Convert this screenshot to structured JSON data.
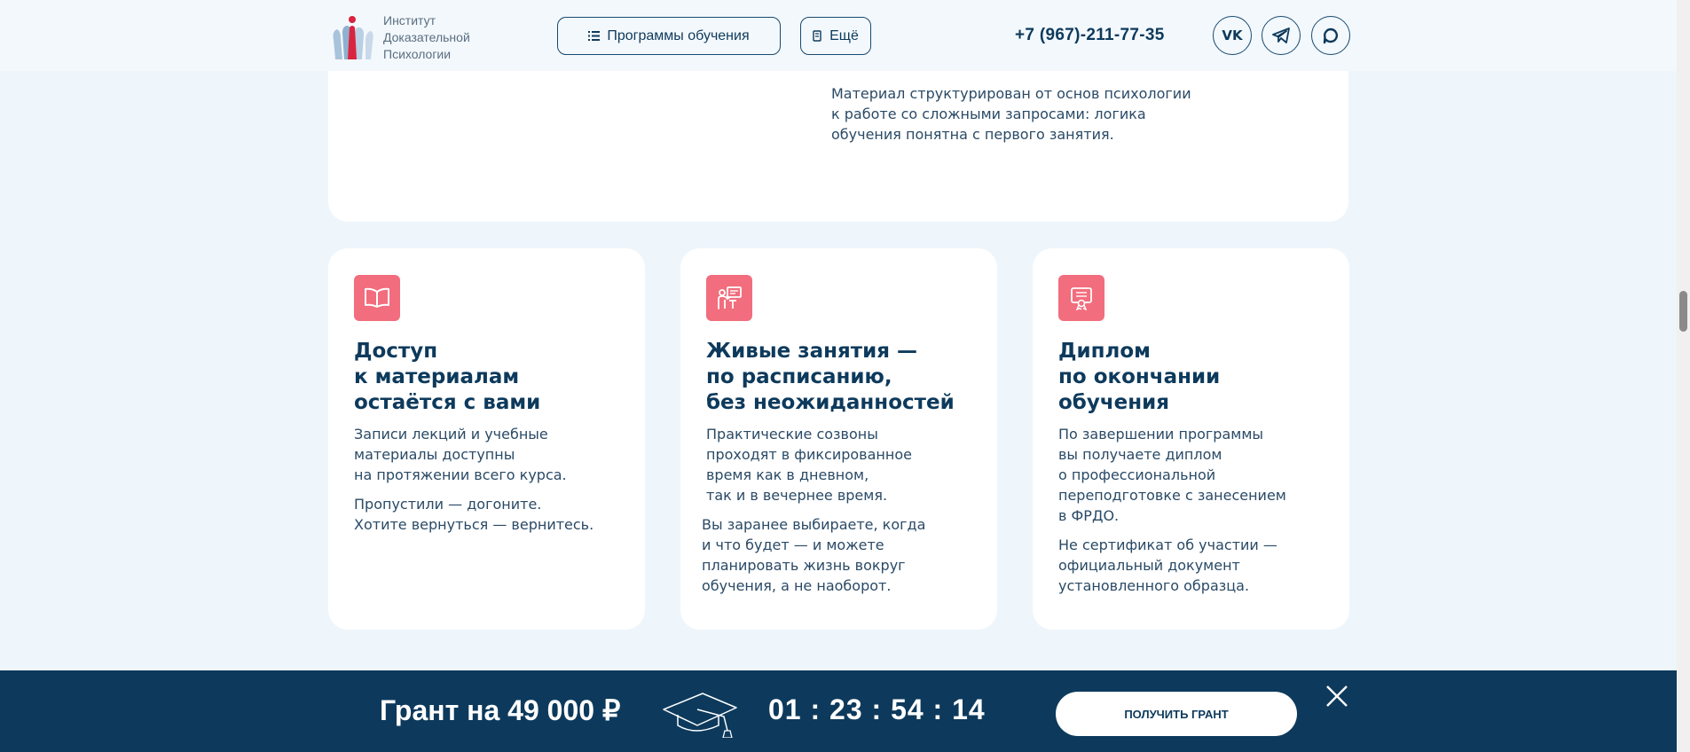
{
  "header": {
    "logo_lines": [
      "Институт",
      "Доказательной",
      "Психологии"
    ],
    "programs_label": "Программы обучения",
    "more_label": "Ещё",
    "phone": "+7 (967)-211-77-35",
    "socials": [
      {
        "name": "vk",
        "label": "VK"
      },
      {
        "name": "telegram",
        "icon": "telegram-icon"
      },
      {
        "name": "max",
        "icon": "max-messenger-icon"
      }
    ]
  },
  "top_card": {
    "lines": [
      "Материал структурирован от основ психологии",
      "к работе со сложными запросами: логика",
      "обучения понятна с первого занятия."
    ]
  },
  "cards": [
    {
      "icon": "book-icon",
      "title": [
        "Доступ",
        "к материалам",
        "остаётся с вами"
      ],
      "paragraphs": [
        [
          "Записи лекций и учебные",
          "материалы доступны",
          "на протяжении всего курса."
        ],
        [
          "Пропустили — догоните.",
          "Хотите вернуться — вернитесь."
        ]
      ]
    },
    {
      "icon": "teacher-board-icon",
      "title": [
        "Живые занятия —",
        "по расписанию,",
        "без неожиданностей"
      ],
      "paragraphs": [
        [
          "Практические созвоны",
          "проходят в фиксированное",
          "время как в дневном,",
          "так и в вечернее время."
        ],
        [
          "Вы заранее выбираете, когда",
          "и что будет — и можете",
          "планировать жизнь вокруг",
          "обучения, а не наоборот."
        ]
      ]
    },
    {
      "icon": "diploma-icon",
      "title": [
        "Диплом",
        "по окончании",
        "обучения"
      ],
      "paragraphs": [
        [
          "По завершении программы",
          "вы получаете диплом",
          "о профессиональной",
          "переподготовке с занесением",
          "в ФРДО."
        ],
        [
          "Не сертификат об участии —",
          "официальный документ",
          "установленного образца."
        ]
      ]
    }
  ],
  "banner": {
    "grant_text": "Грант на 49 000 ₽",
    "timer": "01 : 23 : 54 : 14",
    "button_label": "ПОЛУЧИТЬ ГРАНТ"
  },
  "colors": {
    "accent": "#f26d7d",
    "navy": "#0d3a5c",
    "background": "#eef5fb"
  }
}
